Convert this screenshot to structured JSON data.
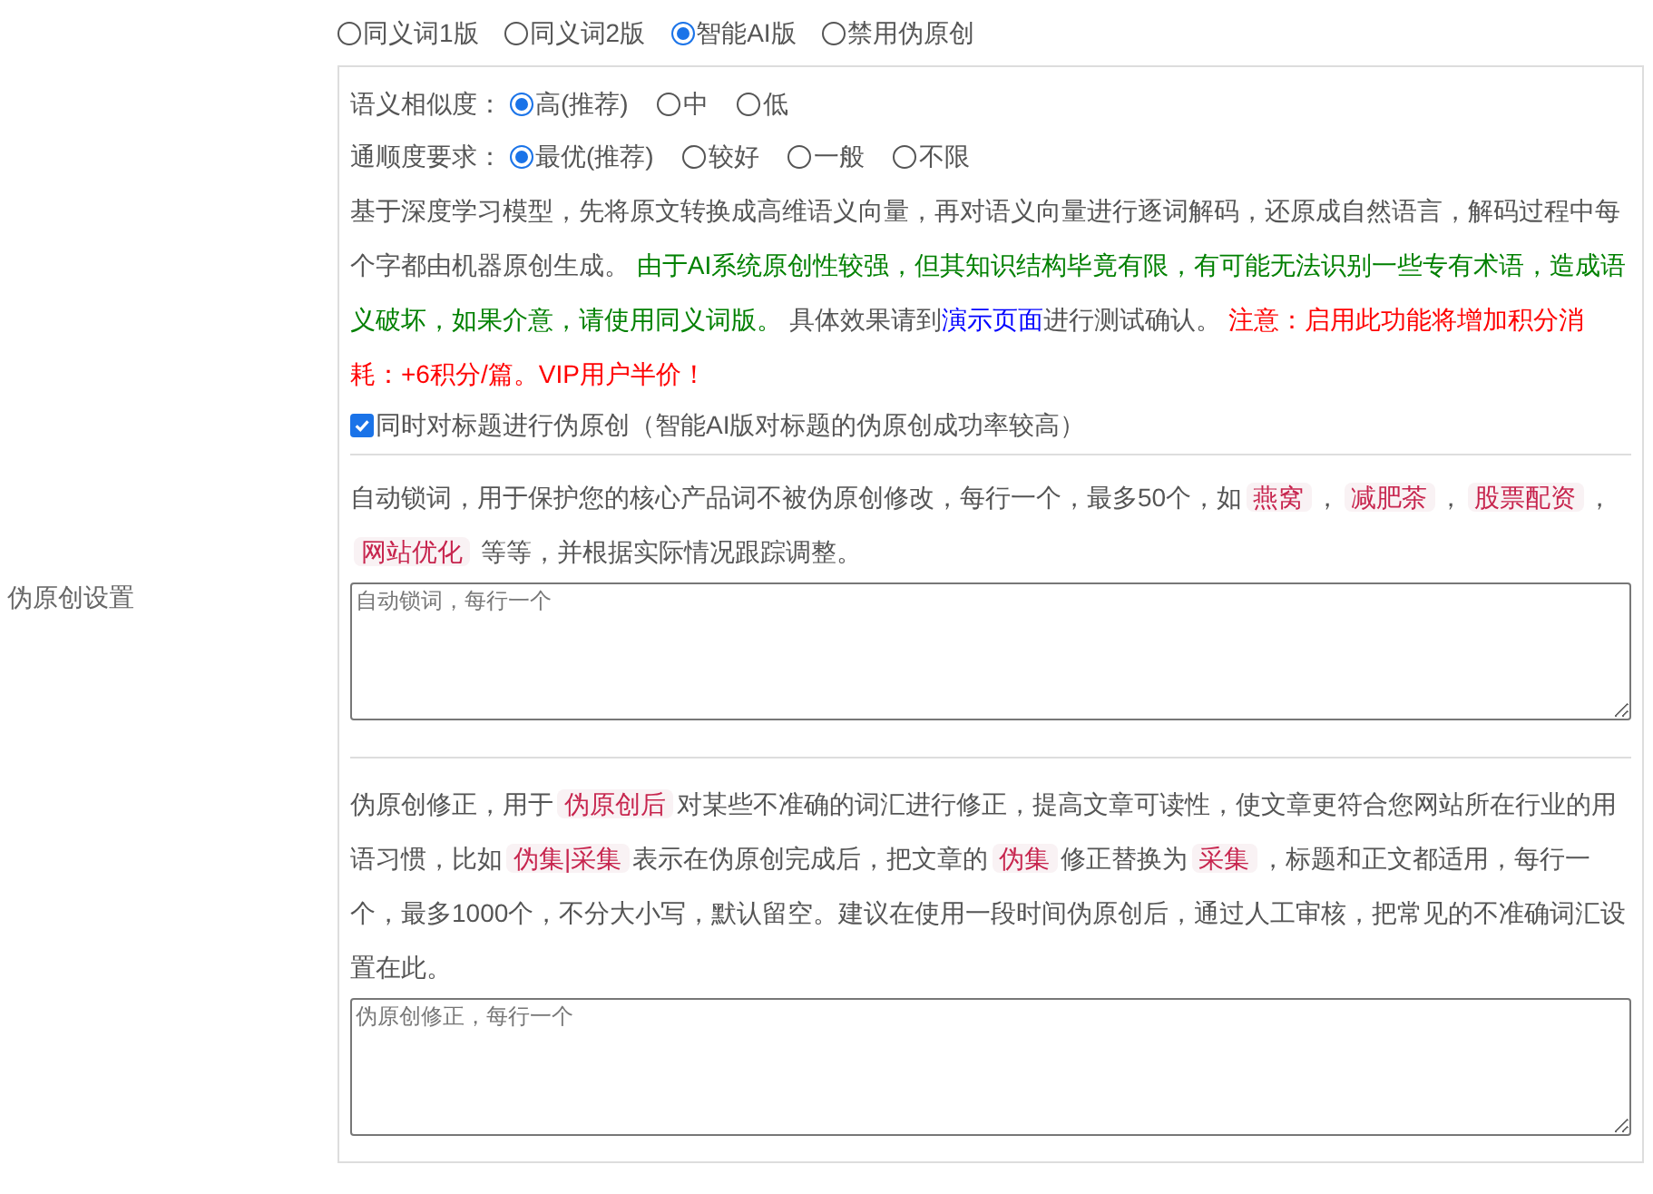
{
  "section_label": "伪原创设置",
  "modes": [
    {
      "label": "同义词1版",
      "selected": false
    },
    {
      "label": "同义词2版",
      "selected": false
    },
    {
      "label": "智能AI版",
      "selected": true
    },
    {
      "label": "禁用伪原创",
      "selected": false
    }
  ],
  "options": [
    {
      "label": "语义相似度：",
      "choices": [
        {
          "label": "高(推荐)",
          "selected": true
        },
        {
          "label": "中",
          "selected": false
        },
        {
          "label": "低",
          "selected": false
        }
      ]
    },
    {
      "label": "通顺度要求：",
      "choices": [
        {
          "label": "最优(推荐)",
          "selected": true
        },
        {
          "label": "较好",
          "selected": false
        },
        {
          "label": "一般",
          "selected": false
        },
        {
          "label": "不限",
          "selected": false
        }
      ]
    }
  ],
  "description": [
    {
      "kind": "plain",
      "text": "基于深度学习模型，先将原文转换成高维语义向量，再对语义向量进行逐词解码，还原成自然语言，解码过程中每个字都由机器原创生成。 "
    },
    {
      "kind": "green",
      "text": "由于AI系统原创性较强，但其知识结构毕竟有限，有可能无法识别一些专有术语，造成语义破坏，如果介意，请使用同义词版。"
    },
    {
      "kind": "plain",
      "text": " 具体效果请到"
    },
    {
      "kind": "link",
      "text": "演示页面"
    },
    {
      "kind": "plain",
      "text": "进行测试确认。 "
    },
    {
      "kind": "red",
      "text": "注意：启用此功能将增加积分消耗：+6积分/篇。VIP用户半价！"
    }
  ],
  "title_option": {
    "label": "同时对标题进行伪原创（智能AI版对标题的伪原创成功率较高）",
    "checked": true
  },
  "lock_words": {
    "description": [
      {
        "kind": "plain",
        "text": "自动锁词，用于保护您的核心产品词不被伪原创修改，每行一个，最多50个，如"
      },
      {
        "kind": "tag",
        "text": "燕窝"
      },
      {
        "kind": "plain",
        "text": "，"
      },
      {
        "kind": "tag",
        "text": "减肥茶"
      },
      {
        "kind": "plain",
        "text": "，"
      },
      {
        "kind": "tag",
        "text": "股票配资"
      },
      {
        "kind": "plain",
        "text": "，"
      },
      {
        "kind": "tag",
        "text": "网站优化"
      },
      {
        "kind": "plain",
        "text": " 等等，并根据实际情况跟踪调整。"
      }
    ],
    "placeholder": "自动锁词，每行一个"
  },
  "corrections": {
    "description": [
      {
        "kind": "plain",
        "text": "伪原创修正，用于"
      },
      {
        "kind": "tag",
        "text": "伪原创后"
      },
      {
        "kind": "plain",
        "text": "对某些不准确的词汇进行修正，提高文章可读性，使文章更符合您网站所在行业的用语习惯，比如"
      },
      {
        "kind": "tag",
        "text": "伪集|采集"
      },
      {
        "kind": "plain",
        "text": "表示在伪原创完成后，把文章的"
      },
      {
        "kind": "tag",
        "text": "伪集"
      },
      {
        "kind": "plain",
        "text": "修正替换为"
      },
      {
        "kind": "tag",
        "text": "采集"
      },
      {
        "kind": "plain",
        "text": "，标题和正文都适用，每行一个，最多1000个，不分大小写，默认留空。建议在使用一段时间伪原创后，通过人工审核，把常见的不准确词汇设置在此。"
      }
    ],
    "placeholder": "伪原创修正，每行一个"
  }
}
